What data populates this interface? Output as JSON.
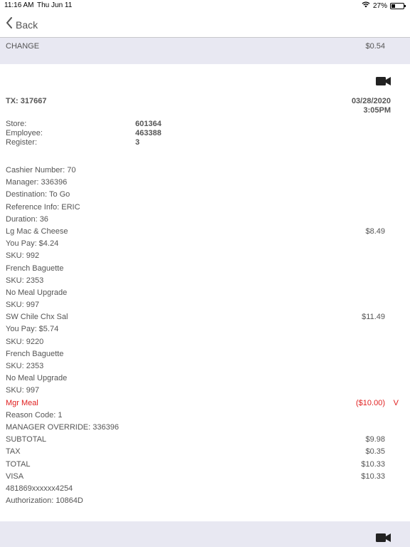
{
  "status_bar": {
    "time": "11:16 AM",
    "date": "Thu Jun 11",
    "battery": "27%"
  },
  "nav": {
    "back_label": "Back"
  },
  "change": {
    "label": "CHANGE",
    "value": "$0.54"
  },
  "transaction": {
    "tx_label": "TX:  317667",
    "date": "03/28/2020",
    "time": "3:05PM",
    "store_label": "Store:",
    "store_value": "601364",
    "employee_label": "Employee:",
    "employee_value": "463388",
    "register_label": "Register:",
    "register_value": "3"
  },
  "lines": [
    {
      "text": "Cashier Number: 70",
      "amount": "",
      "flag": "",
      "red": false
    },
    {
      "text": "Manager: 336396",
      "amount": "",
      "flag": "",
      "red": false
    },
    {
      "text": "Destination: To Go",
      "amount": "",
      "flag": "",
      "red": false
    },
    {
      "text": "Reference Info: ERIC",
      "amount": "",
      "flag": "",
      "red": false
    },
    {
      "text": "Duration: 36",
      "amount": "",
      "flag": "",
      "red": false
    },
    {
      "text": "Lg Mac & Cheese",
      "amount": "$8.49",
      "flag": "",
      "red": false
    },
    {
      "text": "You Pay: $4.24",
      "amount": "",
      "flag": "",
      "red": false
    },
    {
      "text": "SKU: 992",
      "amount": "",
      "flag": "",
      "red": false
    },
    {
      "text": "French Baguette",
      "amount": "",
      "flag": "",
      "red": false
    },
    {
      "text": "SKU: 2353",
      "amount": "",
      "flag": "",
      "red": false
    },
    {
      "text": "No Meal Upgrade",
      "amount": "",
      "flag": "",
      "red": false
    },
    {
      "text": "SKU: 997",
      "amount": "",
      "flag": "",
      "red": false
    },
    {
      "text": "SW Chile Chx Sal",
      "amount": "$11.49",
      "flag": "",
      "red": false
    },
    {
      "text": "You Pay: $5.74",
      "amount": "",
      "flag": "",
      "red": false
    },
    {
      "text": "SKU: 9220",
      "amount": "",
      "flag": "",
      "red": false
    },
    {
      "text": "French Baguette",
      "amount": "",
      "flag": "",
      "red": false
    },
    {
      "text": "SKU: 2353",
      "amount": "",
      "flag": "",
      "red": false
    },
    {
      "text": "No Meal Upgrade",
      "amount": "",
      "flag": "",
      "red": false
    },
    {
      "text": "SKU: 997",
      "amount": "",
      "flag": "",
      "red": false
    },
    {
      "text": "Mgr Meal",
      "amount": "($10.00)",
      "flag": "V",
      "red": true
    },
    {
      "text": "Reason Code: 1",
      "amount": "",
      "flag": "",
      "red": false
    },
    {
      "text": "MANAGER OVERRIDE: 336396",
      "amount": "",
      "flag": "",
      "red": false
    },
    {
      "text": "SUBTOTAL",
      "amount": "$9.98",
      "flag": "",
      "red": false
    },
    {
      "text": "TAX",
      "amount": "$0.35",
      "flag": "",
      "red": false
    },
    {
      "text": "TOTAL",
      "amount": "$10.33",
      "flag": "",
      "red": false
    },
    {
      "text": "VISA",
      "amount": "$10.33",
      "flag": "",
      "red": false
    },
    {
      "text": "481869xxxxxx4254",
      "amount": "",
      "flag": "",
      "red": false
    },
    {
      "text": "Authorization: 10864D",
      "amount": "",
      "flag": "",
      "red": false
    }
  ],
  "icons": {
    "back": "chevron-left-icon",
    "video": "video-camera-icon",
    "wifi": "wifi-icon",
    "battery": "battery-icon"
  },
  "colors": {
    "accent_red": "#e02020",
    "band": "#e8e8f2",
    "text": "#555555"
  }
}
